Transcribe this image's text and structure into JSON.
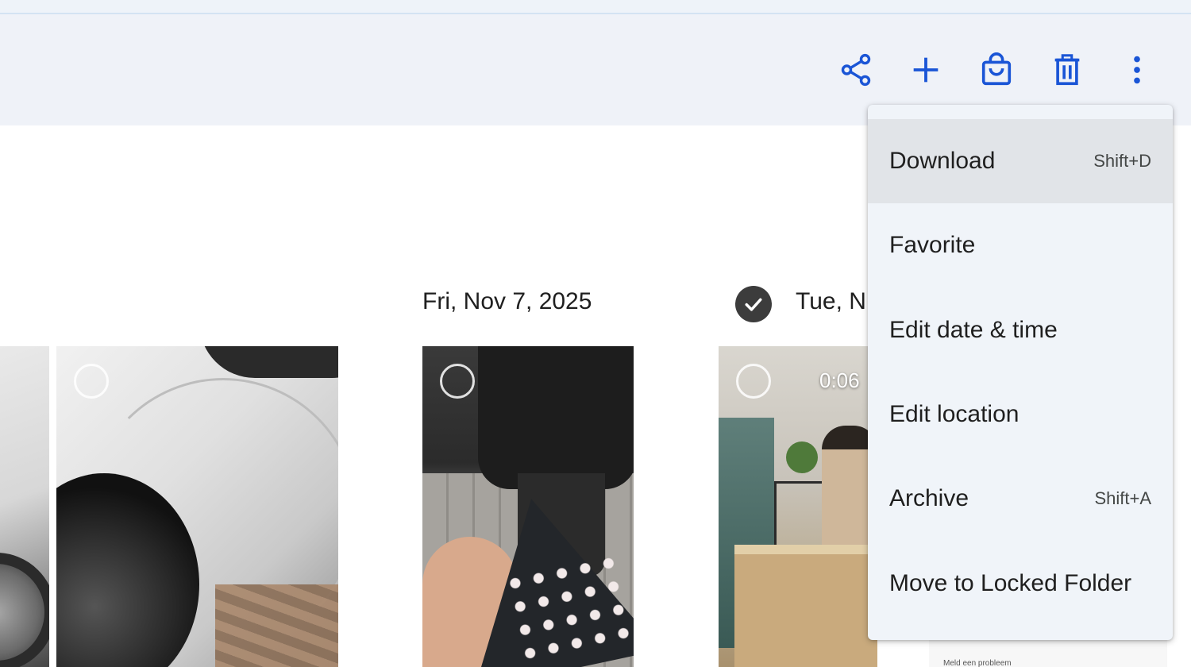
{
  "toolbar": {
    "icons": [
      "share-icon",
      "add-icon",
      "shopping-bag-icon",
      "trash-icon",
      "more-vert-icon"
    ],
    "accent_color": "#1a55d6"
  },
  "content": {
    "dates": [
      {
        "label": "Fri, Nov 7, 2025"
      },
      {
        "label": "Tue, N",
        "selected": true
      }
    ],
    "video": {
      "duration": "0:06"
    },
    "document_snippet": "Meld een probleem"
  },
  "menu": {
    "items": [
      {
        "label": "Download",
        "shortcut": "Shift+D",
        "highlighted": true
      },
      {
        "label": "Favorite",
        "shortcut": ""
      },
      {
        "label": "Edit date & time",
        "shortcut": ""
      },
      {
        "label": "Edit location",
        "shortcut": ""
      },
      {
        "label": "Archive",
        "shortcut": "Shift+A"
      },
      {
        "label": "Move to Locked Folder",
        "shortcut": ""
      }
    ]
  }
}
